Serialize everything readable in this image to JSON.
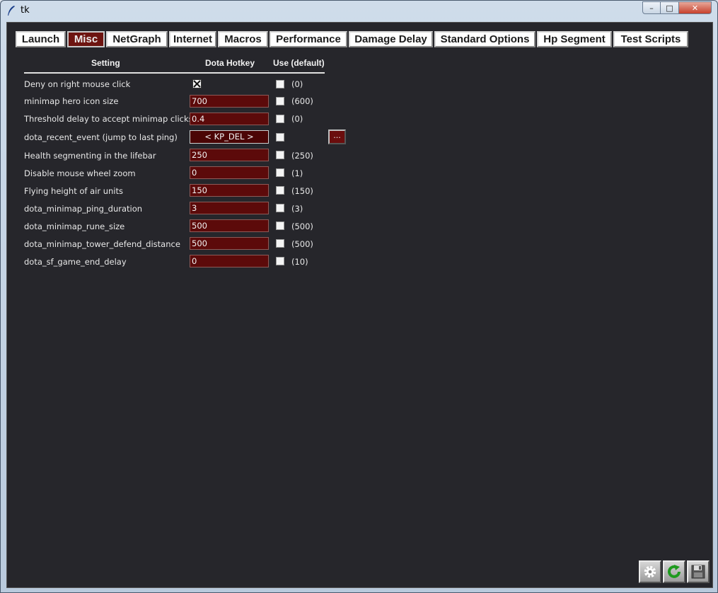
{
  "window": {
    "title": "tk",
    "minimize": "–",
    "maximize": "□",
    "close": "✕"
  },
  "tabs": [
    "Launch",
    "Misc",
    "NetGraph",
    "Internet",
    "Macros",
    "Performance",
    "Damage Delay",
    "Standard Options",
    "Hp Segment",
    "Test Scripts"
  ],
  "active_tab": "Misc",
  "columns": {
    "setting": "Setting",
    "hotkey": "Dota Hotkey",
    "use_default": "Use (default)"
  },
  "rows": [
    {
      "label": "Deny on right mouse click",
      "value": "",
      "checked": true,
      "default": "(0)"
    },
    {
      "label": "minimap hero icon size",
      "value": "700",
      "checked": false,
      "default": "(600)"
    },
    {
      "label": "Threshold delay to accept minimap clicks",
      "value": "0.4",
      "checked": false,
      "default": "(0)"
    },
    {
      "label": "dota_recent_event (jump to last ping)",
      "value": "< KP_DEL >",
      "checked": false,
      "default": "",
      "extra_button": "..."
    },
    {
      "label": "Health segmenting in the lifebar",
      "value": "250",
      "checked": false,
      "default": "(250)"
    },
    {
      "label": "Disable mouse wheel zoom",
      "value": "0",
      "checked": false,
      "default": "(1)"
    },
    {
      "label": "Flying height of air units",
      "value": "150",
      "checked": false,
      "default": "(150)"
    },
    {
      "label": "dota_minimap_ping_duration",
      "value": "3",
      "checked": false,
      "default": "(3)"
    },
    {
      "label": "dota_minimap_rune_size",
      "value": "500",
      "checked": false,
      "default": "(500)"
    },
    {
      "label": "dota_minimap_tower_defend_distance",
      "value": "500",
      "checked": false,
      "default": "(500)"
    },
    {
      "label": "dota_sf_game_end_delay",
      "value": "0",
      "checked": false,
      "default": "(10)"
    }
  ],
  "toolbar": {
    "settings_icon": "gear-icon",
    "refresh_icon": "refresh-icon",
    "save_icon": "save-icon"
  },
  "colors": {
    "background": "#26262b",
    "field": "#5c0a0a",
    "active_tab": "#6d1410"
  }
}
